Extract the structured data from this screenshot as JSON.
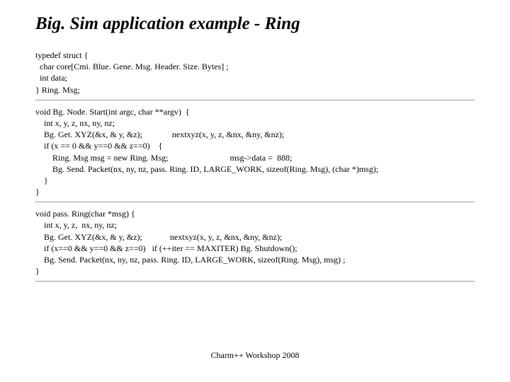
{
  "title": "Big. Sim application example - Ring",
  "code_block_1": "typedef struct {\n  char core[Cmi. Blue. Gene. Msg. Header. Size. Bytes] ;\n  int data;\n} Ring. Msg;",
  "code_block_2": "void Bg. Node. Start(int argc, char **argv)  {\n    int x, y, z, nx, ny, nz;\n    Bg. Get. XYZ(&x, & y, &z);              nextxyz(x, y, z, &nx, &ny, &nz);\n    if (x == 0 && y==0 && z==0)    {\n        Ring. Msg msg = new Ring. Msg;                             msg->data =  888;\n        Bg. Send. Packet(nx, ny, nz, pass. Ring. ID, LARGE_WORK, sizeof(Ring. Msg), (char *)msg);\n    }\n}",
  "code_block_3": "void pass. Ring(char *msg) {\n    int x, y, z,  nx, ny, nz;\n    Bg. Get. XYZ(&x, & y, &z);             nextxyz(x, y, z, &nx, &ny, &nz);\n    if (x==0 && y==0 && z==0)   if (++iter == MAXITER) Bg. Shutdown();\n    Bg. Send. Packet(nx, ny, nz, pass. Ring. ID, LARGE_WORK, sizeof(Ring. Msg), msg) ;\n}",
  "footer": "Charm++ Workshop 2008"
}
